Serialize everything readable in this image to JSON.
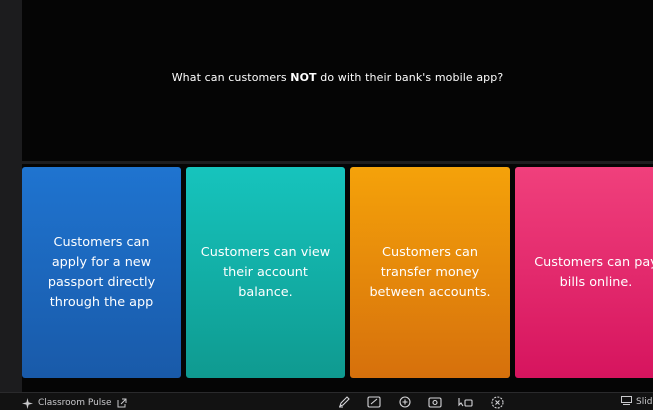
{
  "question": {
    "before": "What can customers ",
    "emphasis": "NOT",
    "after": " do with their bank's mobile app?"
  },
  "options": [
    {
      "text": "Customers can apply for a new passport directly through the app",
      "color": "#1f74d0"
    },
    {
      "text": "Customers can view their account balance.",
      "color": "#16c4bd"
    },
    {
      "text": "Customers can transfer money between accounts.",
      "color": "#f5a20a"
    },
    {
      "text": "Customers can pay bills online.",
      "color": "#f0407c"
    }
  ],
  "bottom_bar": {
    "pulse_label": "Classroom Pulse",
    "slide_label": "Slid",
    "tools": [
      "pen-icon",
      "drawing-board-icon",
      "add-icon",
      "visibility-icon",
      "pointer-icon",
      "close-circle-icon"
    ]
  }
}
